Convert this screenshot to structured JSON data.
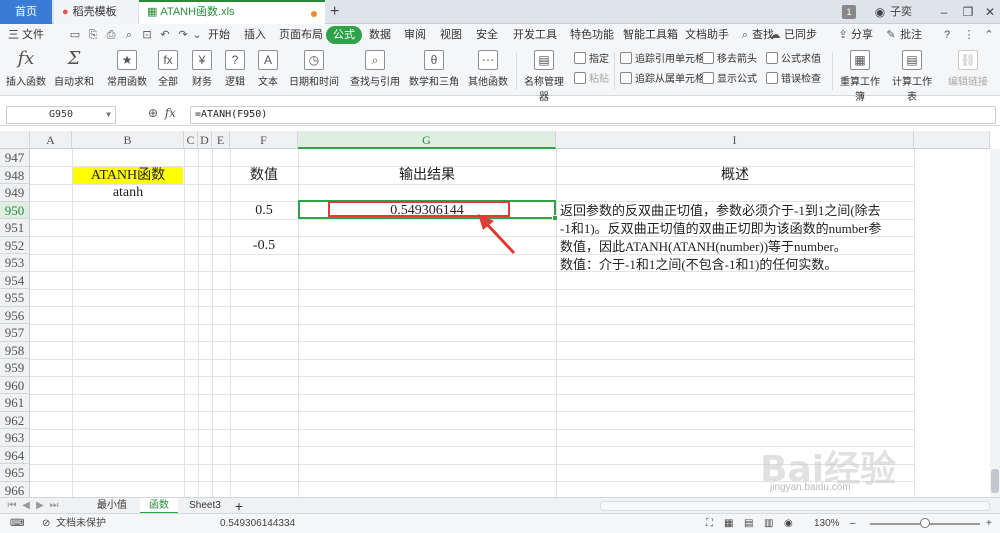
{
  "tabbar": {
    "home": "首页",
    "template_tab": "稻壳模板",
    "file_tab": "ATANH函数.xls",
    "plus": "+",
    "page_badge": "1",
    "user": "子奕"
  },
  "menubar": {
    "file": "三 文件",
    "items": [
      "开始",
      "插入",
      "页面布局",
      "公式",
      "数据",
      "审阅",
      "视图",
      "安全",
      "开发工具",
      "特色功能",
      "智能工具箱",
      "文档助手",
      "查找"
    ],
    "active_index": 3,
    "sync": "已同步",
    "share": "分享",
    "comment": "批注"
  },
  "ribbon": {
    "insert_function": "插入函数",
    "autosum": "自动求和",
    "common_fn": "常用函数",
    "all": "全部",
    "finance": "财务",
    "logic": "逻辑",
    "text": "文本",
    "datetime": "日期和时间",
    "lookup": "查找与引用",
    "math": "数学和三角",
    "other": "其他函数",
    "name_manager": "名称管理器",
    "specify": "指定",
    "paste": "粘贴",
    "trace_precedents": "追踪引用单元格",
    "trace_dependents": "追踪从属单元格",
    "remove_arrows": "移去箭头",
    "show_formulas": "显示公式",
    "evaluate": "公式求值",
    "error_check": "错误检查",
    "recalc_sheet": "重算工作簿",
    "calc_sheet": "计算工作表",
    "edit_links": "编辑链接"
  },
  "formula_bar": {
    "name_box": "G950",
    "formula": "=ATANH(F950)"
  },
  "columns": [
    "A",
    "B",
    "C",
    "D",
    "E",
    "F",
    "G",
    "I"
  ],
  "rows": [
    "947",
    "948",
    "949",
    "950",
    "951",
    "952",
    "953",
    "954",
    "955",
    "956",
    "957",
    "958",
    "959",
    "960",
    "961",
    "962",
    "963",
    "964",
    "965",
    "966"
  ],
  "cells": {
    "b948": "ATANH函数",
    "b949": "atanh",
    "f948": "数值",
    "g948": "输出结果",
    "i948": "概述",
    "f950": "0.5",
    "g950": "0.549306144",
    "f952": "-0.5",
    "desc": [
      "返回参数的反双曲正切值，参数必须介于-1到1之间(除去",
      "-1和1)。反双曲正切值的双曲正切即为该函数的number参",
      "数值，因此ATANH(ATANH(number))等于number。",
      " 数值：介于-1和1之间(不包含-1和1)的任何实数。"
    ]
  },
  "sheets": [
    "最小值",
    "函数",
    "Sheet3"
  ],
  "active_sheet_index": 1,
  "status": {
    "protect": "文档未保护",
    "value": "0.549306144334",
    "zoom": "130%"
  },
  "watermark": {
    "brand": "Bai经验",
    "url": "jingyan.baidu.com"
  },
  "colors": {
    "accent_green": "#2fa34a",
    "highlight_yellow": "#ffff00",
    "annotation_red": "#e53935"
  }
}
